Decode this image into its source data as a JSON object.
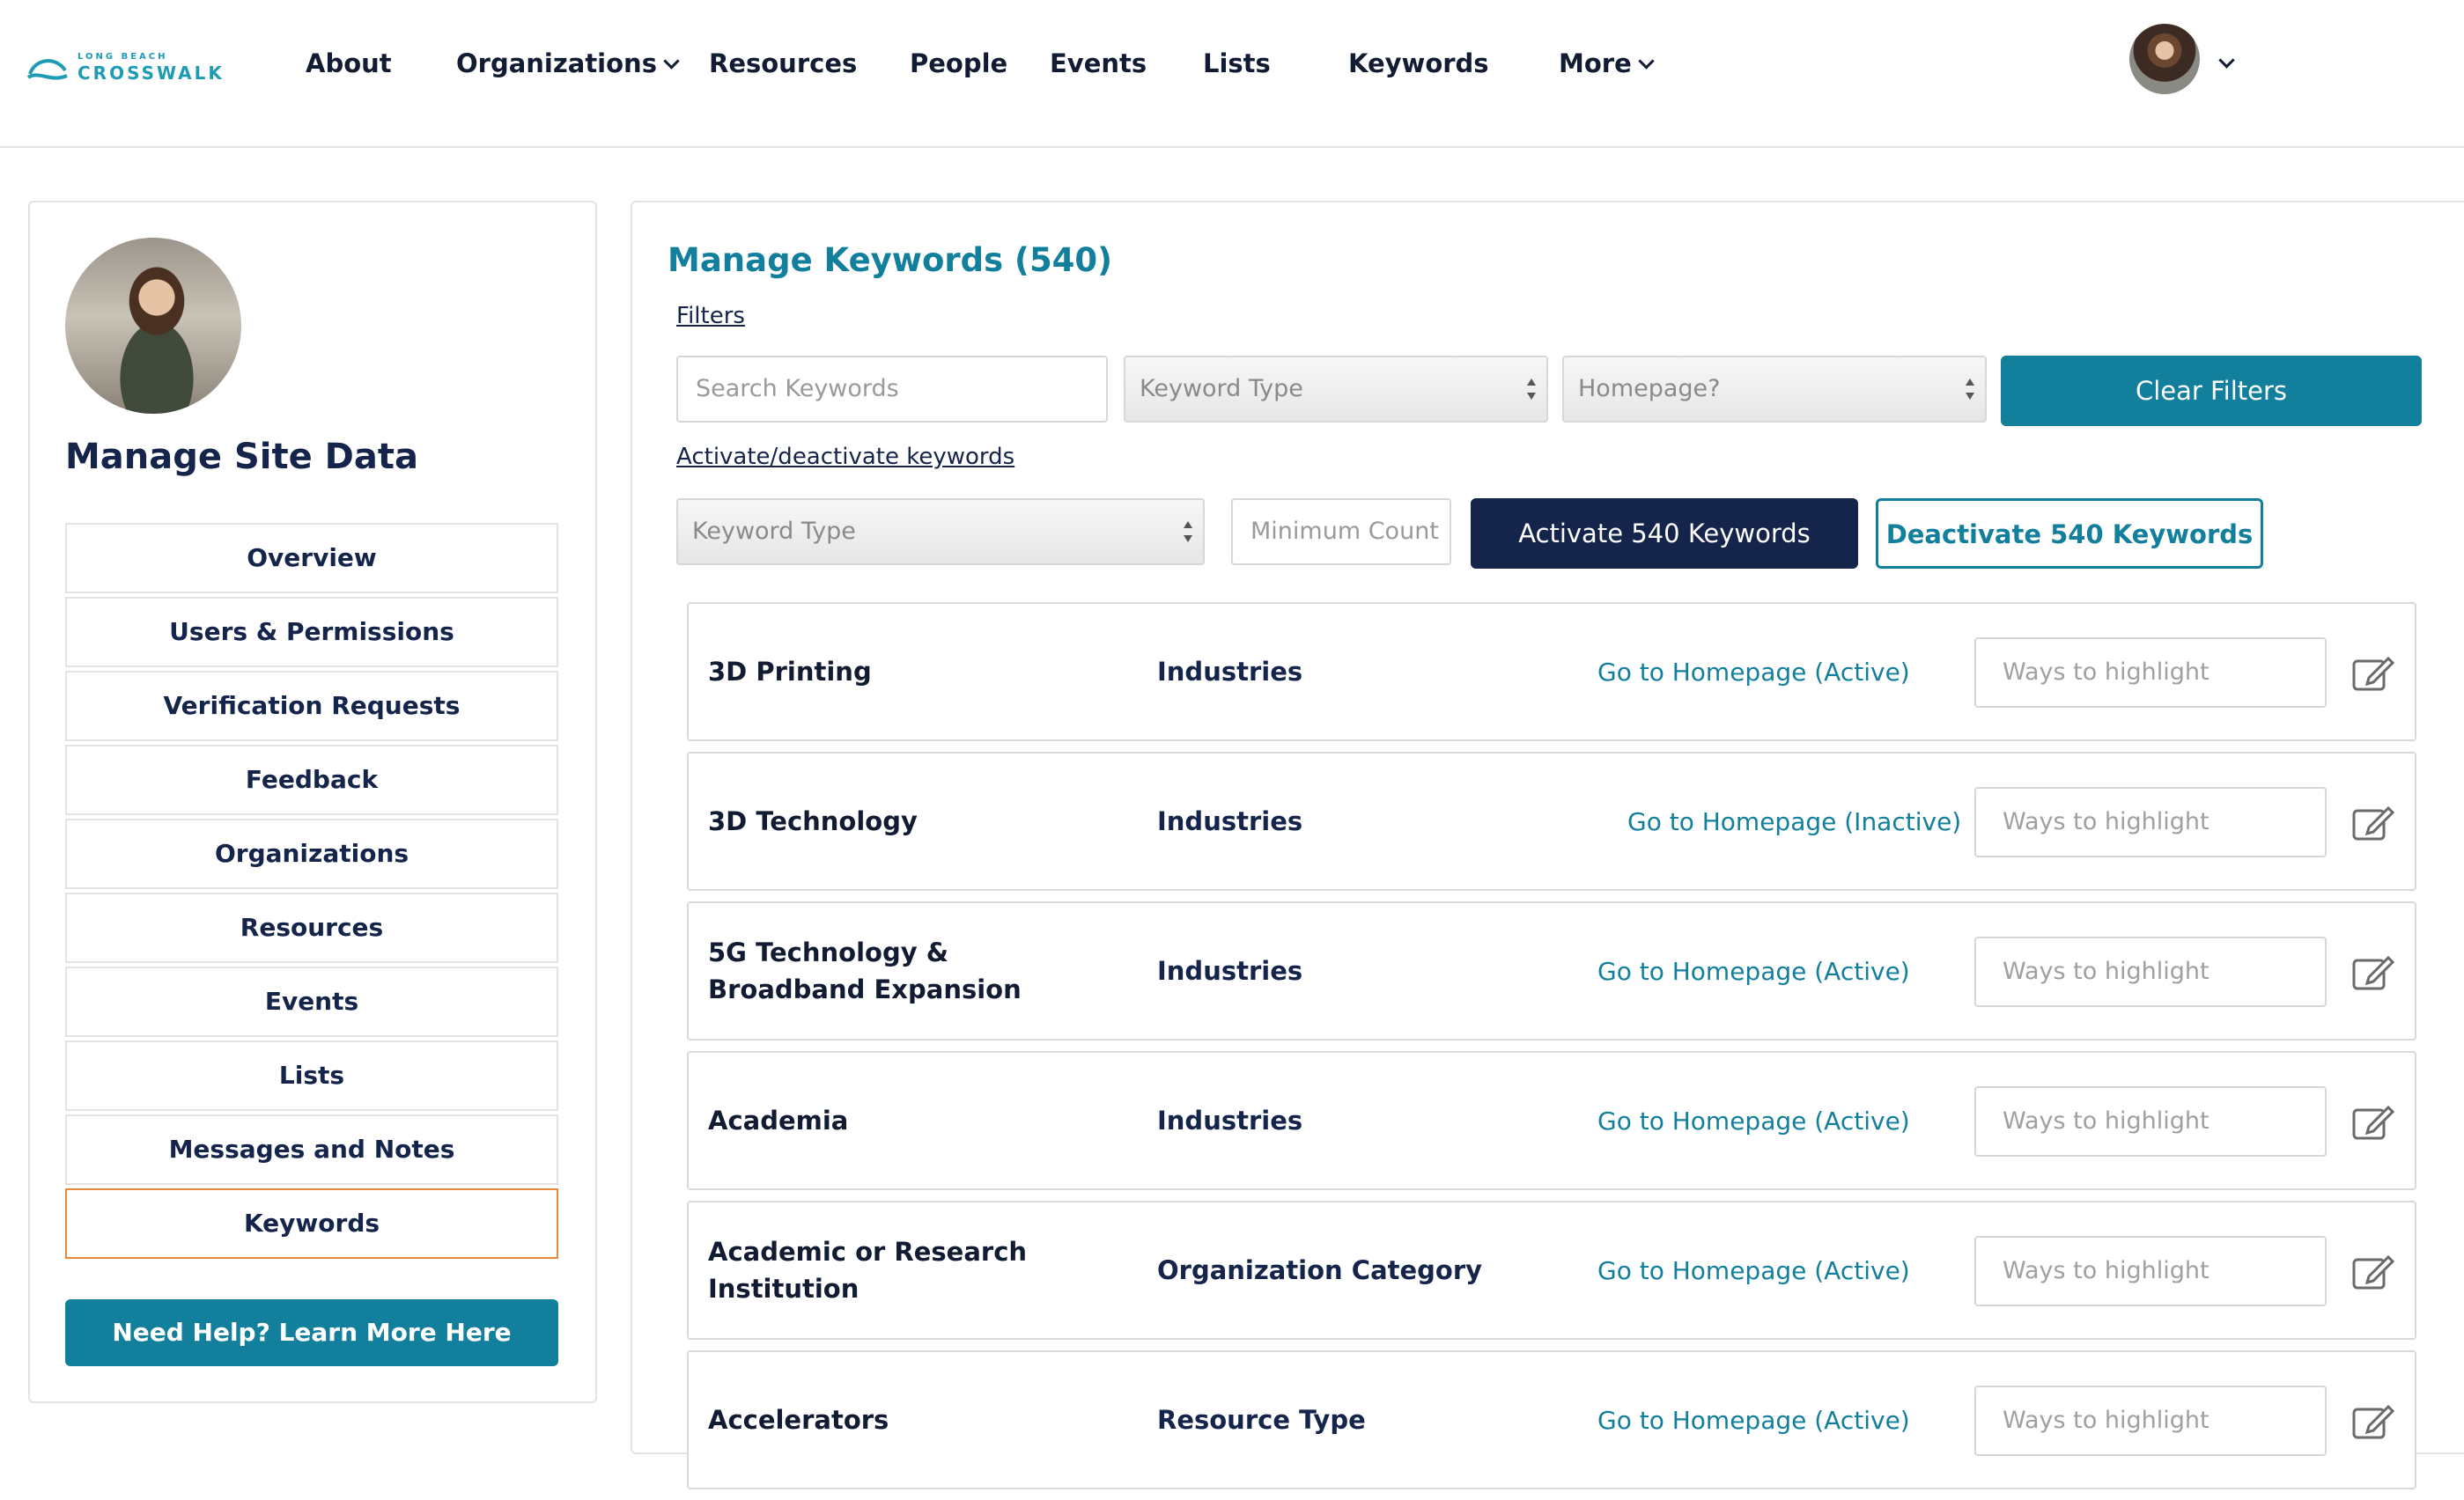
{
  "brand": {
    "logo_small": "LONG BEACH",
    "logo_big": "CROSSWALK"
  },
  "nav": {
    "items": [
      "About",
      "Organizations",
      "Resources",
      "People",
      "Events",
      "Lists",
      "Keywords",
      "More"
    ]
  },
  "sidebar": {
    "title": "Manage Site Data",
    "items": [
      "Overview",
      "Users & Permissions",
      "Verification Requests",
      "Feedback",
      "Organizations",
      "Resources",
      "Events",
      "Lists",
      "Messages and Notes",
      "Keywords"
    ],
    "active_item": "Keywords",
    "help_button": "Need Help? Learn More Here"
  },
  "main": {
    "title": "Manage Keywords (540)",
    "filters_label": "Filters",
    "search_placeholder": "Search Keywords",
    "keyword_type_select": "Keyword Type",
    "homepage_select": "Homepage?",
    "clear_filters": "Clear Filters",
    "activate_label": "Activate/deactivate keywords",
    "bulk_keyword_type": "Keyword Type",
    "minimum_count_placeholder": "Minimum Count",
    "activate_button": "Activate 540 Keywords",
    "deactivate_button": "Deactivate 540 Keywords",
    "highlight_placeholder": "Ways to highlight",
    "rows": [
      {
        "name": "3D Printing",
        "type": "Industries",
        "link": "Go to Homepage (Active)"
      },
      {
        "name": "3D Technology",
        "type": "Industries",
        "link": "Go to Homepage (Inactive)"
      },
      {
        "name": "5G Technology & Broadband Expansion",
        "type": "Industries",
        "link": "Go to Homepage (Active)"
      },
      {
        "name": "Academia",
        "type": "Industries",
        "link": "Go to Homepage (Active)"
      },
      {
        "name": "Academic or Research Institution",
        "type": "Organization Category",
        "link": "Go to Homepage (Active)"
      },
      {
        "name": "Accelerators",
        "type": "Resource Type",
        "link": "Go to Homepage (Active)"
      }
    ]
  },
  "colors": {
    "teal": "#127f9c",
    "navy": "#14244a",
    "active_border": "#e8883a"
  }
}
